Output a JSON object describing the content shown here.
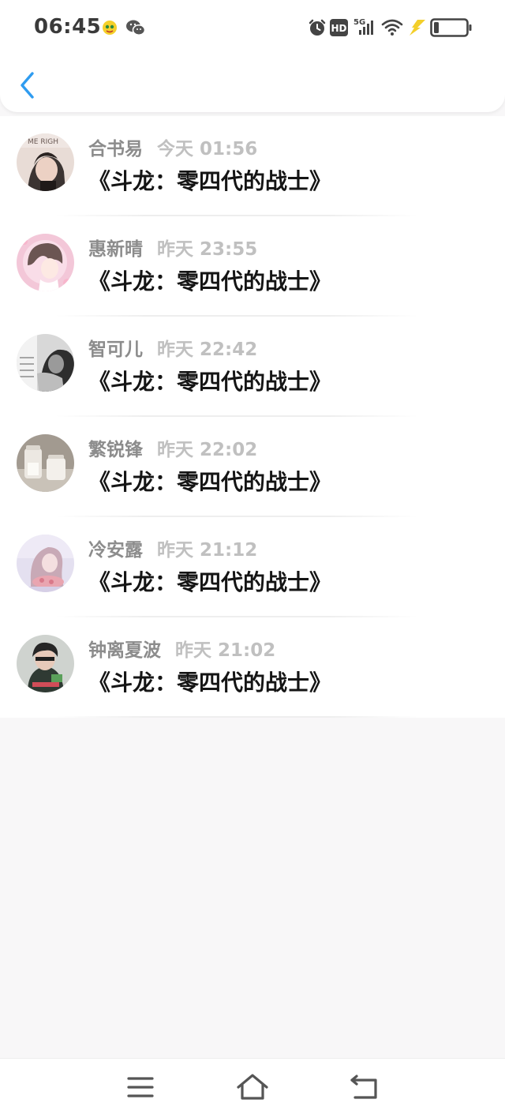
{
  "status_bar": {
    "time": "06:45",
    "network": "5G",
    "hd_label": "HD",
    "battery_level": 0.15,
    "icons": [
      "app-notification-icon",
      "wechat-icon",
      "alarm-icon",
      "hd-icon",
      "signal-icon",
      "wifi-icon",
      "charging-icon",
      "battery-icon"
    ]
  },
  "header": {
    "back_icon": "chevron-left-icon",
    "accent_color": "#2f9cf0"
  },
  "items": [
    {
      "name": "合书易",
      "time": "今天 01:56",
      "title": "《斗龙：零四代的战士》"
    },
    {
      "name": "惠新晴",
      "time": "昨天 23:55",
      "title": "《斗龙：零四代的战士》"
    },
    {
      "name": "智可儿",
      "time": "昨天 22:42",
      "title": "《斗龙：零四代的战士》"
    },
    {
      "name": "繁锐锋",
      "time": "昨天 22:02",
      "title": "《斗龙：零四代的战士》"
    },
    {
      "name": "冷安露",
      "time": "昨天 21:12",
      "title": "《斗龙：零四代的战士》"
    },
    {
      "name": "钟离夏波",
      "time": "昨天 21:02",
      "title": "《斗龙：零四代的战士》"
    }
  ],
  "avatar_images": {
    "1": "ME RIGH"
  },
  "nav_bar": {
    "icons": [
      "menu-icon",
      "home-icon",
      "back-icon"
    ]
  }
}
